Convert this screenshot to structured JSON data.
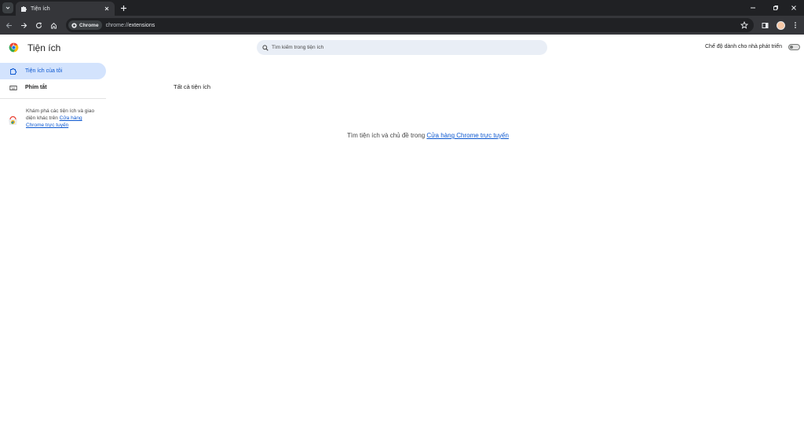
{
  "browser": {
    "tab": {
      "title": "Tiện ích",
      "icon": "puzzle-icon",
      "close_icon": "close-icon"
    },
    "omnibox": {
      "chip_label": "Chrome",
      "url_scheme": "chrome://",
      "url_host": "extensions"
    }
  },
  "header": {
    "title": "Tiện ích",
    "search_placeholder": "Tìm kiếm trong tiện ích",
    "dev_mode_label": "Chế độ dành cho nhà phát triển"
  },
  "sidebar": {
    "items": [
      {
        "label": "Tiện ích của tôi",
        "icon": "puzzle-icon",
        "active": true
      },
      {
        "label": "Phím tắt",
        "icon": "keyboard-icon",
        "active": false
      }
    ],
    "store_promo": {
      "text": "Khám phá các tiện ích và giao diện khác trên ",
      "link": "Cửa hàng Chrome trực tuyến"
    }
  },
  "main": {
    "section_title": "Tất cả tiện ích",
    "empty_text": "Tìm tiện ích và chủ đề trong ",
    "empty_link": "Cửa hàng Chrome trực tuyến"
  },
  "colors": {
    "accent": "#0b57d0",
    "active_bg": "#d3e3fd",
    "search_bg": "#e9eef6",
    "titlebar": "#202124",
    "toolbar": "#35363a"
  }
}
